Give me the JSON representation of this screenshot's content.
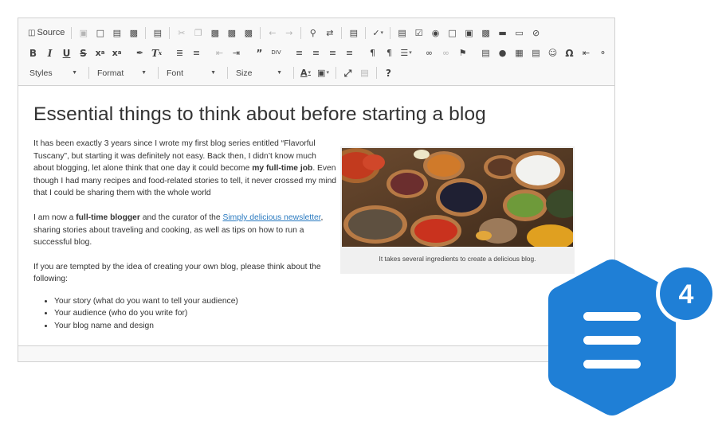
{
  "toolbar": {
    "row1": [
      "source-button",
      "sep",
      "save-icon",
      "new-page-icon",
      "preview-icon",
      "print-icon",
      "sep",
      "templates-icon",
      "sep",
      "cut-icon",
      "copy-icon",
      "paste-icon",
      "paste-text-icon",
      "paste-word-icon",
      "sep",
      "undo-icon",
      "redo-icon",
      "sep",
      "find-icon",
      "replace-icon",
      "sep",
      "select-all-icon",
      "sep",
      "spellcheck-icon",
      "sep",
      "form-icon",
      "checkbox-icon",
      "radio-icon",
      "textfield-icon",
      "textarea-icon",
      "select-icon",
      "button-icon",
      "image-button-icon",
      "hidden-field-icon"
    ],
    "source_label": "Source",
    "styles_label": "Styles",
    "format_label": "Format",
    "font_label": "Font",
    "size_label": "Size",
    "help_label": "?"
  },
  "article": {
    "title": "Essential things to think about before starting a blog",
    "p1": "It has been exactly 3 years since I wrote my first blog series entitled “Flavorful Tuscany”, but starting it was definitely not easy. Back then, I didn’t know much about blogging, let alone think that one day it could become ",
    "p1_bold": "my full-time job",
    "p1_end": ". Even though I had many recipes and food-related stories to tell, it never crossed my mind that I could be sharing them with the whole world",
    "p2_start": "I am now a ",
    "p2_bold": "full-time blogger",
    "p2_mid": " and the curator of the ",
    "p2_link": "Simply delicious newsletter",
    "p2_end": ", sharing stories about traveling and cooking, as well as tips on how to run a successful blog.",
    "p3": "If you are tempted by the idea of creating your own blog, please think about the following:",
    "list": [
      "Your story (what do you want to tell your audience)",
      "Your audience (who do you write for)",
      "Your blog name and design"
    ],
    "caption": "It takes several ingredients to create a delicious blog."
  },
  "badge": {
    "count": "4",
    "hex_color": "#1f7fd6",
    "circle_color": "#1f7fd6"
  }
}
